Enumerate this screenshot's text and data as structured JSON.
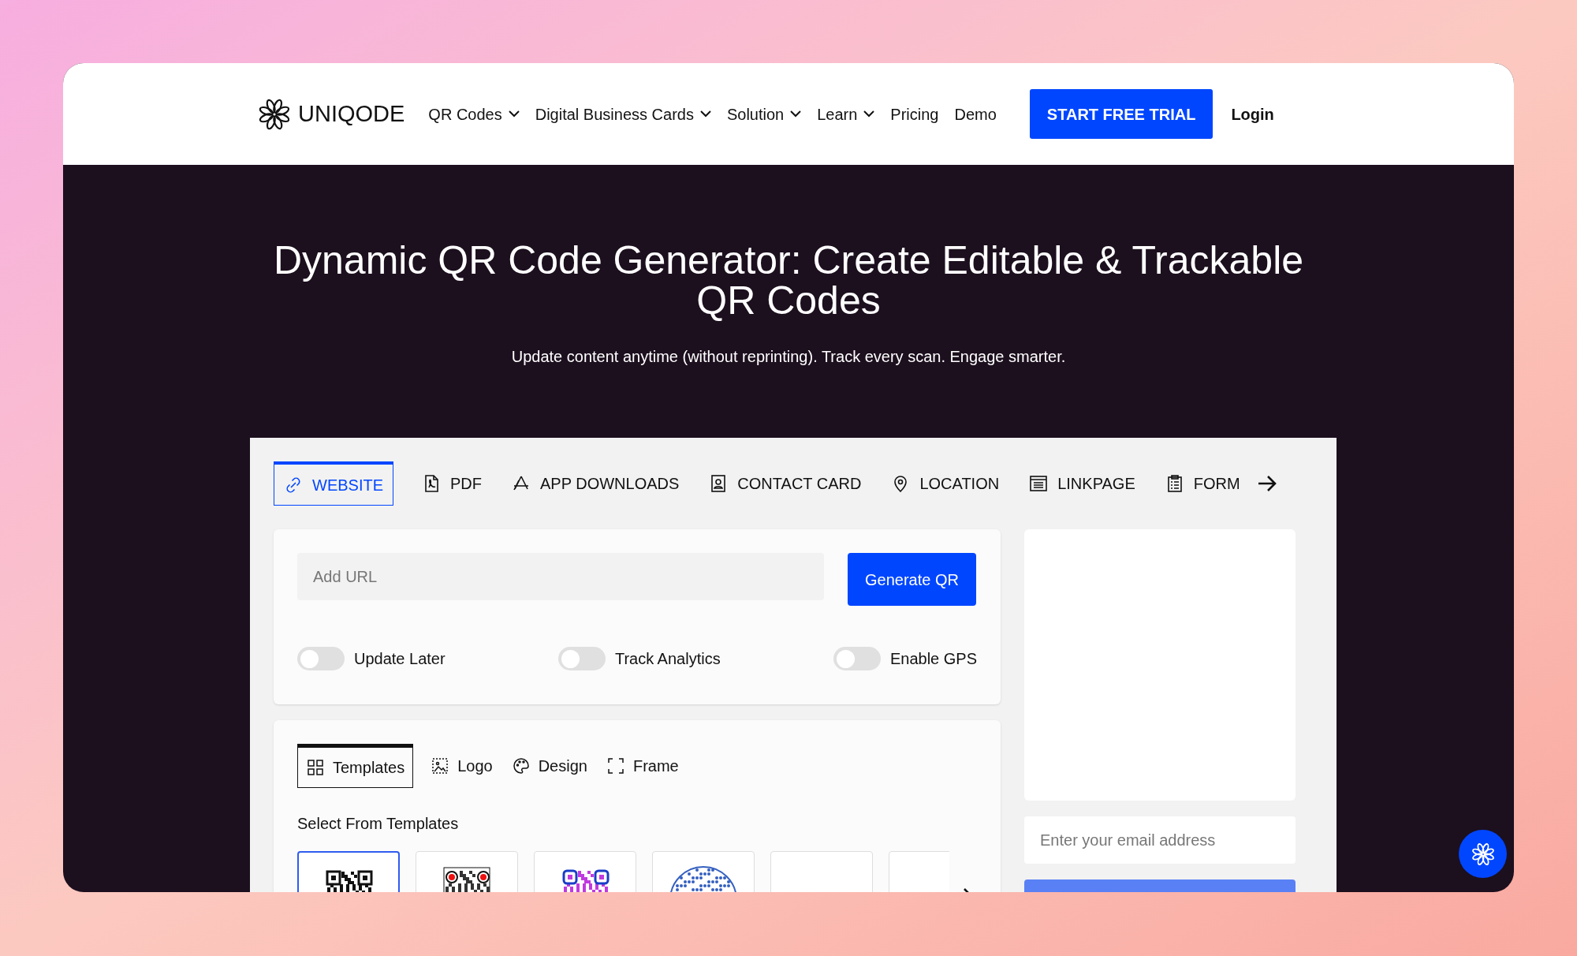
{
  "nav": {
    "logo": "UNIQODE",
    "items": [
      {
        "label": "QR Codes",
        "dropdown": true
      },
      {
        "label": "Digital Business Cards",
        "dropdown": true
      },
      {
        "label": "Solution",
        "dropdown": true
      },
      {
        "label": "Learn",
        "dropdown": true
      },
      {
        "label": "Pricing",
        "dropdown": false
      },
      {
        "label": "Demo",
        "dropdown": false
      }
    ],
    "cta": "START FREE TRIAL",
    "login": "Login"
  },
  "hero": {
    "title": "Dynamic QR Code Generator: Create Editable & Trackable QR Codes",
    "subtitle": "Update content anytime (without reprinting). Track every scan. Engage smarter."
  },
  "type_tabs": [
    {
      "label": "WEBSITE",
      "selected": true
    },
    {
      "label": "PDF",
      "selected": false
    },
    {
      "label": "APP DOWNLOADS",
      "selected": false
    },
    {
      "label": "CONTACT CARD",
      "selected": false
    },
    {
      "label": "LOCATION",
      "selected": false
    },
    {
      "label": "LINKPAGE",
      "selected": false
    },
    {
      "label": "FORM",
      "selected": false
    }
  ],
  "url_field": {
    "placeholder": "Add URL"
  },
  "generate_button": "Generate QR",
  "toggles": [
    {
      "label": "Update Later",
      "on": false
    },
    {
      "label": "Track Analytics",
      "on": false
    },
    {
      "label": "Enable GPS",
      "on": false
    }
  ],
  "design_tabs": [
    {
      "label": "Templates",
      "selected": true
    },
    {
      "label": "Logo",
      "selected": false
    },
    {
      "label": "Design",
      "selected": false
    },
    {
      "label": "Frame",
      "selected": false
    }
  ],
  "templates_title": "Select From Templates",
  "templates": [
    {
      "kind": "classic",
      "selected": true
    },
    {
      "kind": "red-eyes",
      "selected": false
    },
    {
      "kind": "gradient",
      "selected": false
    },
    {
      "kind": "round",
      "selected": false
    },
    {
      "kind": "blank",
      "selected": false
    },
    {
      "kind": "blank",
      "selected": false
    }
  ],
  "email_field": {
    "placeholder": "Enter your email address"
  }
}
